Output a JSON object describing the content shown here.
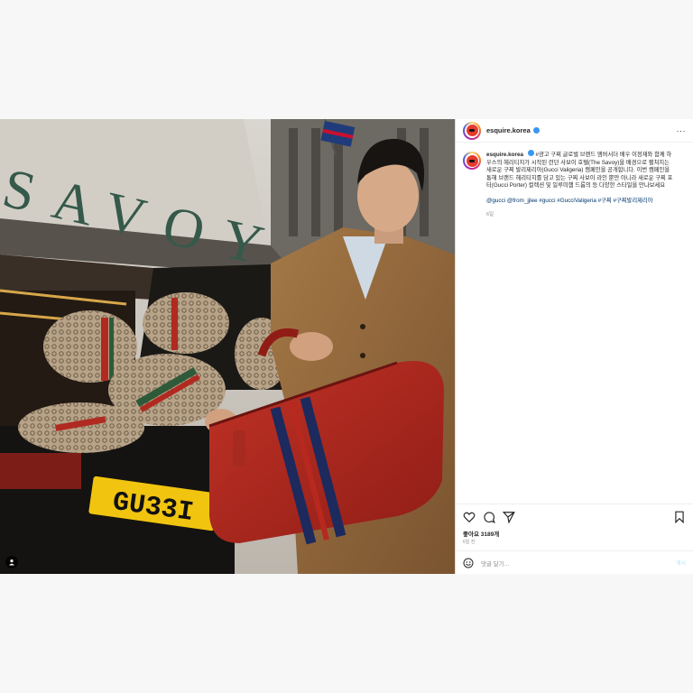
{
  "post": {
    "username": "esquire.korea",
    "more_label": "···",
    "caption_prefix": "#광고 구찌 글로벌 브랜드 앰버서더 배우 이정재와 함께 하우스의 헤리티지가 시작된 런던 사보이 호텔(The Savoy)을 배경으로 펼쳐지는 새로운 구찌 발리제리아(Gucci Valigeria) 캠페인을 공개합니다. 이번 캠페인을 통해 브랜드 헤리티지를 담고 있는 구찌 사보이 라인 뿐만 아니라 새로운 구찌 포터(Gucci Porter) 컬렉션 및 일루미햄 드롭의 등 다양한 스타일을 만나보세요",
    "caption_tags": "@gucci @from_jjlee #gucci #GucciValigeria #구찌 #구찌발리제리아",
    "time_ago": "6일",
    "likes_label": "좋아요",
    "likes_count": "3189개",
    "date_label": "6일 전",
    "comment_placeholder": "댓글 달기...",
    "post_button": "게시"
  },
  "photo": {
    "sign_text": "SAVOY",
    "plate_text": "GU33I"
  },
  "icons": {
    "more": "more-icon",
    "heart": "heart-icon",
    "comment": "comment-icon",
    "share": "share-icon",
    "save": "bookmark-icon",
    "emoji": "emoji-icon",
    "tagged": "person-tag-icon"
  }
}
